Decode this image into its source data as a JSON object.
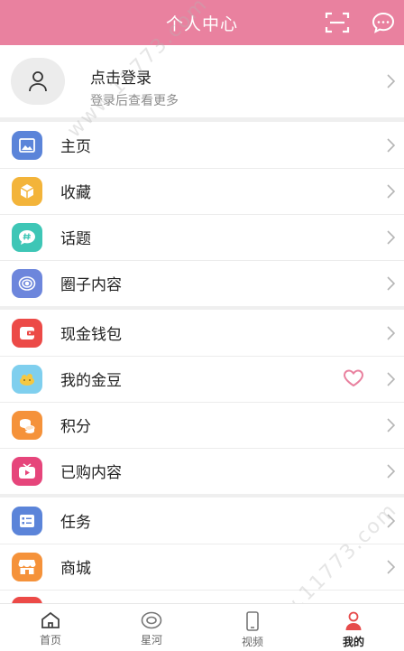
{
  "header": {
    "title": "个人中心",
    "scan_icon": "scan-icon",
    "message_icon": "message-icon"
  },
  "login": {
    "title": "点击登录",
    "subtitle": "登录后查看更多"
  },
  "groups": [
    {
      "items": [
        {
          "label": "主页",
          "icon": "image-icon",
          "color": "#5b84d9"
        },
        {
          "label": "收藏",
          "icon": "box-icon",
          "color": "#f3b43a"
        },
        {
          "label": "话题",
          "icon": "hashtag-icon",
          "color": "#3ec6b6"
        },
        {
          "label": "圈子内容",
          "icon": "circle-icon",
          "color": "#6d86dc"
        }
      ]
    },
    {
      "items": [
        {
          "label": "现金钱包",
          "icon": "wallet-icon",
          "color": "#ec4a47"
        },
        {
          "label": "我的金豆",
          "icon": "bean-icon",
          "color": "#7fcfee"
        },
        {
          "label": "积分",
          "icon": "coins-icon",
          "color": "#f5923a"
        },
        {
          "label": "已购内容",
          "icon": "tv-icon",
          "color": "#e6457b"
        }
      ]
    },
    {
      "items": [
        {
          "label": "任务",
          "icon": "task-icon",
          "color": "#5b84d9"
        },
        {
          "label": "商城",
          "icon": "shop-icon",
          "color": "#f5923a"
        }
      ]
    }
  ],
  "tabs": [
    {
      "label": "首页",
      "icon": "home-icon"
    },
    {
      "label": "星河",
      "icon": "eye-icon"
    },
    {
      "label": "视频",
      "icon": "phone-icon"
    },
    {
      "label": "我的",
      "icon": "user-icon",
      "active": true
    }
  ],
  "watermark": "www.11773.com",
  "colors": {
    "header": "#e9819f",
    "accent": "#e9819f"
  }
}
